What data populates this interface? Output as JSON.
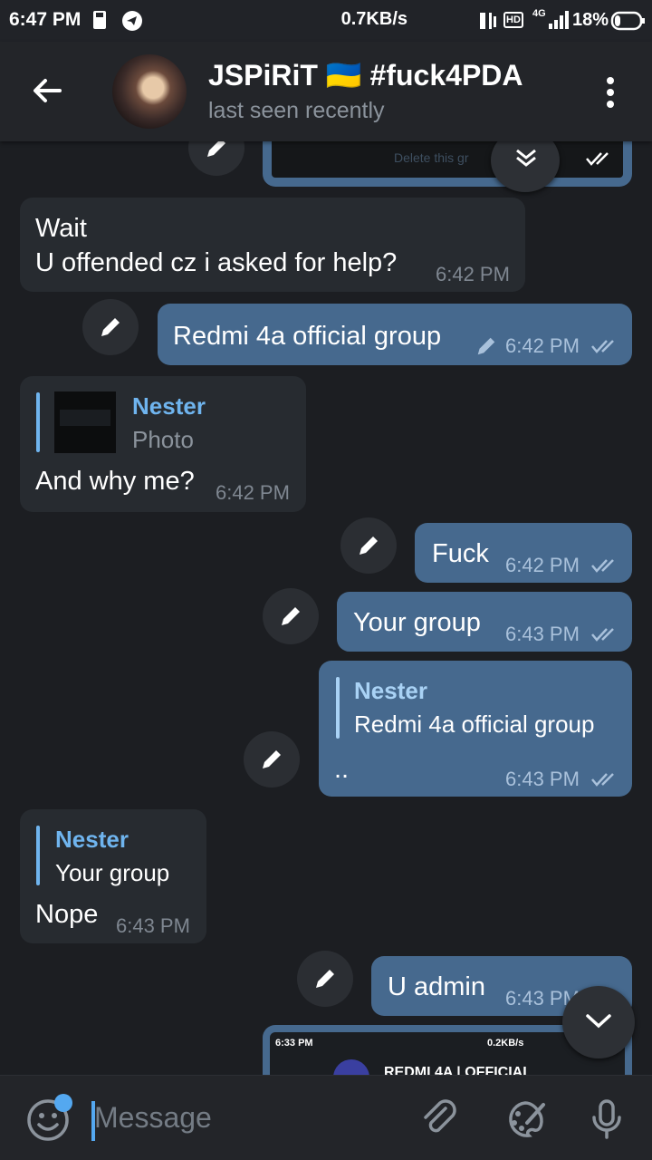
{
  "status": {
    "time": "6:47 PM",
    "net_speed": "0.7KB/s",
    "hd": "HD",
    "net_type": "4G",
    "battery": "18%"
  },
  "header": {
    "title": "JSPiRiT 🇺🇦 #fuck4PDA",
    "subtitle": "last seen recently",
    "icons": [
      "back-arrow-icon",
      "kebab-menu-icon"
    ]
  },
  "messages": {
    "top_partial_text": "Delete this gr",
    "m1_line1": "Wait",
    "m1_line2": "U offended cz i asked for help?",
    "m1_time": "6:42 PM",
    "m2_text": "Redmi 4a official group",
    "m2_time": "6:42 PM",
    "m3_reply_name": "Nester",
    "m3_reply_text": "Photo",
    "m3_text": "And why me?",
    "m3_time": "6:42 PM",
    "m4_text": "Fuck",
    "m4_time": "6:42 PM",
    "m5_text": "Your group",
    "m5_time": "6:43 PM",
    "m6_reply_name": "Nester",
    "m6_reply_text": "Redmi 4a official group",
    "m6_text": "..",
    "m6_time": "6:43 PM",
    "m7_reply_name": "Nester",
    "m7_reply_text": "Your group",
    "m7_text": "Nope",
    "m7_time": "6:43 PM",
    "m8_text": "U admin",
    "m8_time": "6:43 PM",
    "bottom_shot_time": "6:33 PM",
    "bottom_shot_speed": "0.2KB/s",
    "bottom_shot_title": "REDMI 4A | OFFICIAL"
  },
  "input": {
    "placeholder": "Message",
    "icons": [
      "emoji-icon",
      "attach-icon",
      "paint-icon",
      "mic-icon"
    ]
  },
  "colors": {
    "bg": "#1c1e22",
    "incoming": "#272b30",
    "outgoing": "#46698e",
    "accent": "#6fb4ee"
  }
}
